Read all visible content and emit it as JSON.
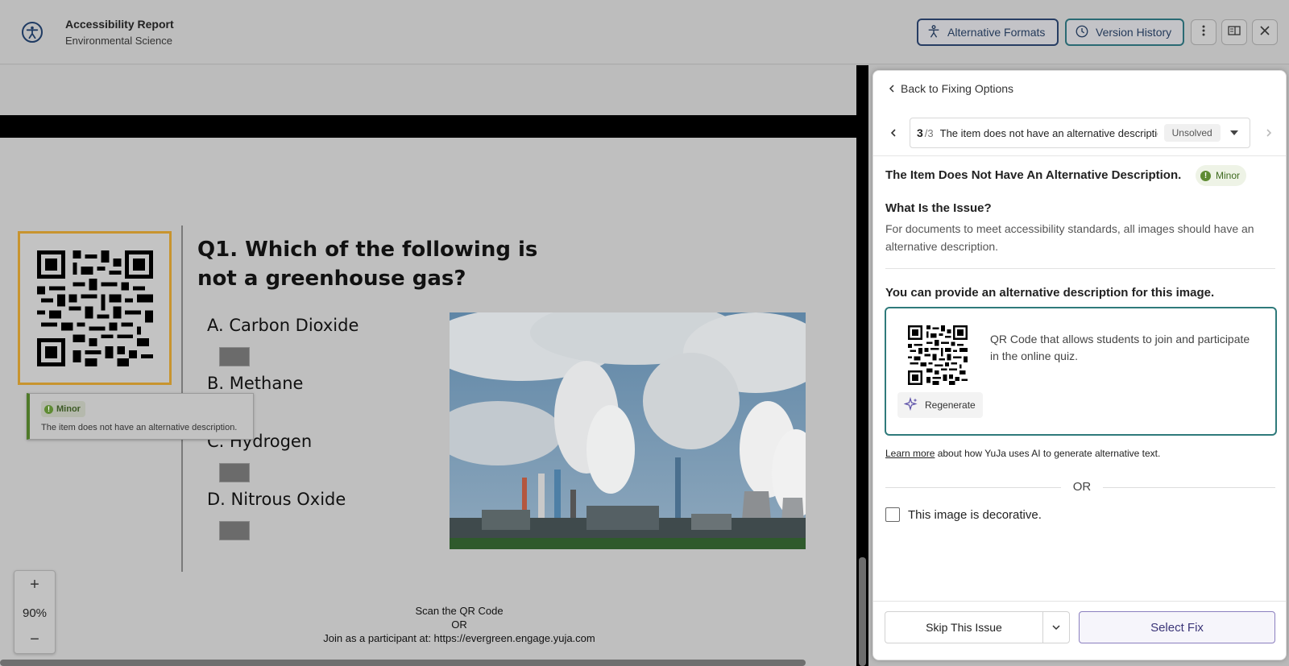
{
  "header": {
    "title": "Accessibility Report",
    "subtitle": "Environmental Science",
    "alt_formats_label": "Alternative Formats",
    "version_history_label": "Version History",
    "icons": [
      "accessibility-icon",
      "alternative-formats-icon",
      "version-history-icon",
      "more-icon",
      "panel-toggle-icon",
      "close-icon"
    ]
  },
  "document": {
    "question": "Q1. Which of the following is not a greenhouse gas?",
    "options": [
      "A. Carbon Dioxide",
      "B. Methane",
      "C. Hydrogen",
      "D. Nitrous Oxide"
    ],
    "tooltip": {
      "severity": "Minor",
      "message": "The item does not have an alternative description."
    },
    "footer": {
      "line1": "Scan the QR Code",
      "line2": "OR",
      "line3": "Join as a participant at: https://evergreen.engage.yuja.com"
    },
    "zoom": {
      "plus": "+",
      "value": "90%",
      "minus": "−"
    }
  },
  "panel": {
    "back_label": "Back to Fixing Options",
    "nav": {
      "current": "3",
      "total": "/3",
      "issue_text": "The item does not have an alternative description.",
      "status": "Unsolved"
    },
    "issue_title": "The Item Does Not Have An Alternative Description.",
    "severity": "Minor",
    "what_heading": "What Is the Issue?",
    "what_body": "For documents to meet accessibility standards, all images should have an alternative description.",
    "provide_heading": "You can provide an alternative description for this image.",
    "alt_text_value": "QR Code that allows students to join and participate in the online quiz.",
    "regenerate_label": "Regenerate",
    "learn_more_link": "Learn more",
    "learn_more_rest": " about how YuJa uses AI to generate alternative text.",
    "or_label": "OR",
    "decorative_label": "This image is decorative.",
    "skip_label": "Skip This Issue",
    "select_fix_label": "Select Fix"
  },
  "colors": {
    "accent_teal": "#2f7a7b",
    "focus_gold": "#c8942f",
    "minor_green": "#5e8b33",
    "select_fix_purple": "#3b3578"
  }
}
